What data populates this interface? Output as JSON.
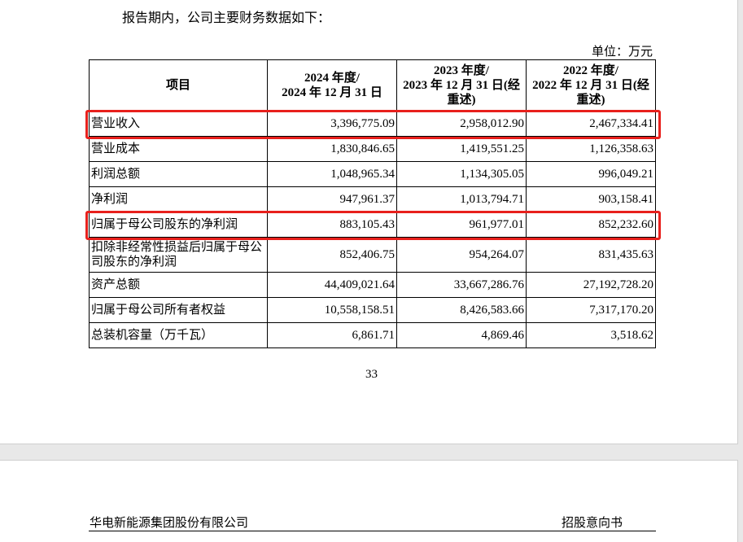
{
  "intro": "报告期内，公司主要财务数据如下：",
  "unit": "单位：万元",
  "table": {
    "headers": [
      "项目",
      "2024 年度/\n2024 年 12 月 31 日",
      "2023 年度/\n2023 年 12 月 31 日(经重述)",
      "2022 年度/\n2022 年 12 月 31 日(经重述)"
    ],
    "rows": [
      {
        "label": "营业收入",
        "values": [
          "3,396,775.09",
          "2,958,012.90",
          "2,467,334.41"
        ],
        "highlighted": true
      },
      {
        "label": "营业成本",
        "values": [
          "1,830,846.65",
          "1,419,551.25",
          "1,126,358.63"
        ]
      },
      {
        "label": "利润总额",
        "values": [
          "1,048,965.34",
          "1,134,305.05",
          "996,049.21"
        ]
      },
      {
        "label": "净利润",
        "values": [
          "947,961.37",
          "1,013,794.71",
          "903,158.41"
        ]
      },
      {
        "label": "归属于母公司股东的净利润",
        "values": [
          "883,105.43",
          "961,977.01",
          "852,232.60"
        ],
        "highlighted": true
      },
      {
        "label": "扣除非经常性损益后归属于母公司股东的净利润",
        "values": [
          "852,406.75",
          "954,264.07",
          "831,435.63"
        ]
      },
      {
        "label": "资产总额",
        "values": [
          "44,409,021.64",
          "33,667,286.76",
          "27,192,728.20"
        ]
      },
      {
        "label": "归属于母公司所有者权益",
        "values": [
          "10,558,158.51",
          "8,426,583.66",
          "7,317,170.20"
        ]
      },
      {
        "label": "总装机容量（万千瓦）",
        "values": [
          "6,861.71",
          "4,869.46",
          "3,518.62"
        ]
      }
    ]
  },
  "page_number": "33",
  "next_page": {
    "company": "华电新能源集团股份有限公司",
    "doc_type": "招股意向书"
  },
  "highlight_color": "#e8201c"
}
